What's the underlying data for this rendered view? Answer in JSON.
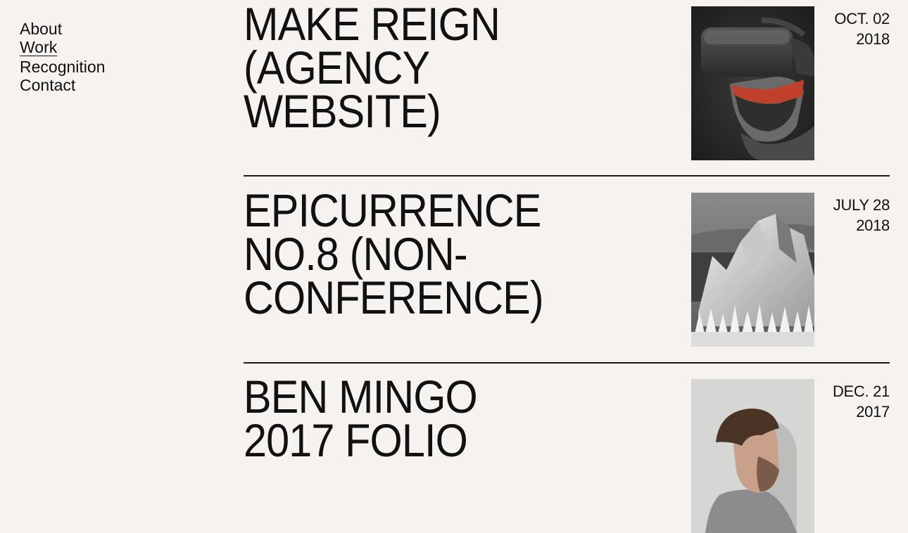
{
  "nav": {
    "items": [
      {
        "label": "About"
      },
      {
        "label": "Work",
        "active": true
      },
      {
        "label": "Recognition"
      },
      {
        "label": "Contact"
      }
    ]
  },
  "projects": [
    {
      "title": "MAKE REIGN\n(AGENCY\nWEBSITE)",
      "date_line1": "OCT. 02",
      "date_line2": "2018",
      "image": "vr-headset-sculpture-image"
    },
    {
      "title": "EPICURRENCE\nNO.8 (NON-\nCONFERENCE)",
      "date_line1": "JULY 28",
      "date_line2": "2018",
      "image": "mountain-landscape-image"
    },
    {
      "title": "BEN MINGO\n2017 FOLIO",
      "date_line1": "DEC. 21",
      "date_line2": "2017",
      "image": "man-portrait-image"
    }
  ],
  "colors": {
    "background": "#f5f2ef",
    "text": "#111111",
    "rule": "#1a1a1a"
  }
}
